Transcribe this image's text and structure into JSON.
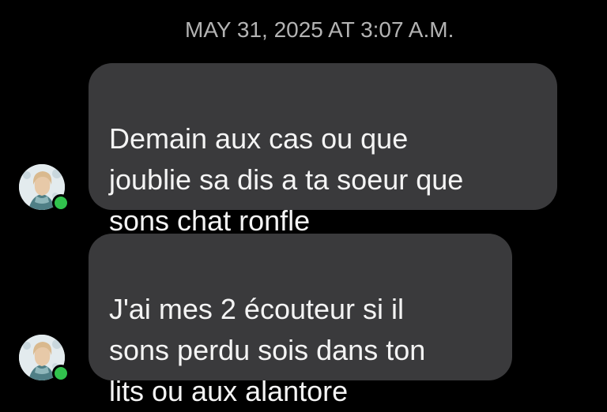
{
  "conversation": {
    "timestamp": "MAY 31, 2025 AT 3:07 A.M.",
    "messages": [
      {
        "text": "Demain aux cas ou que\njoublie sa dis a ta soeur que\nsons chat ronfle",
        "sender_status": "online"
      },
      {
        "text": "J'ai mes 2 écouteur si il\nsons perdu sois dans ton\nlits ou aux alantore",
        "sender_status": "online"
      }
    ]
  },
  "colors": {
    "background": "#000000",
    "bubble": "#3a3a3c",
    "bubble_text": "#f4f4f4",
    "timestamp_text": "#b3b3b3",
    "online_indicator": "#31c24d"
  },
  "icons": {
    "avatar": "profile-photo",
    "presence": "online-dot-icon"
  }
}
